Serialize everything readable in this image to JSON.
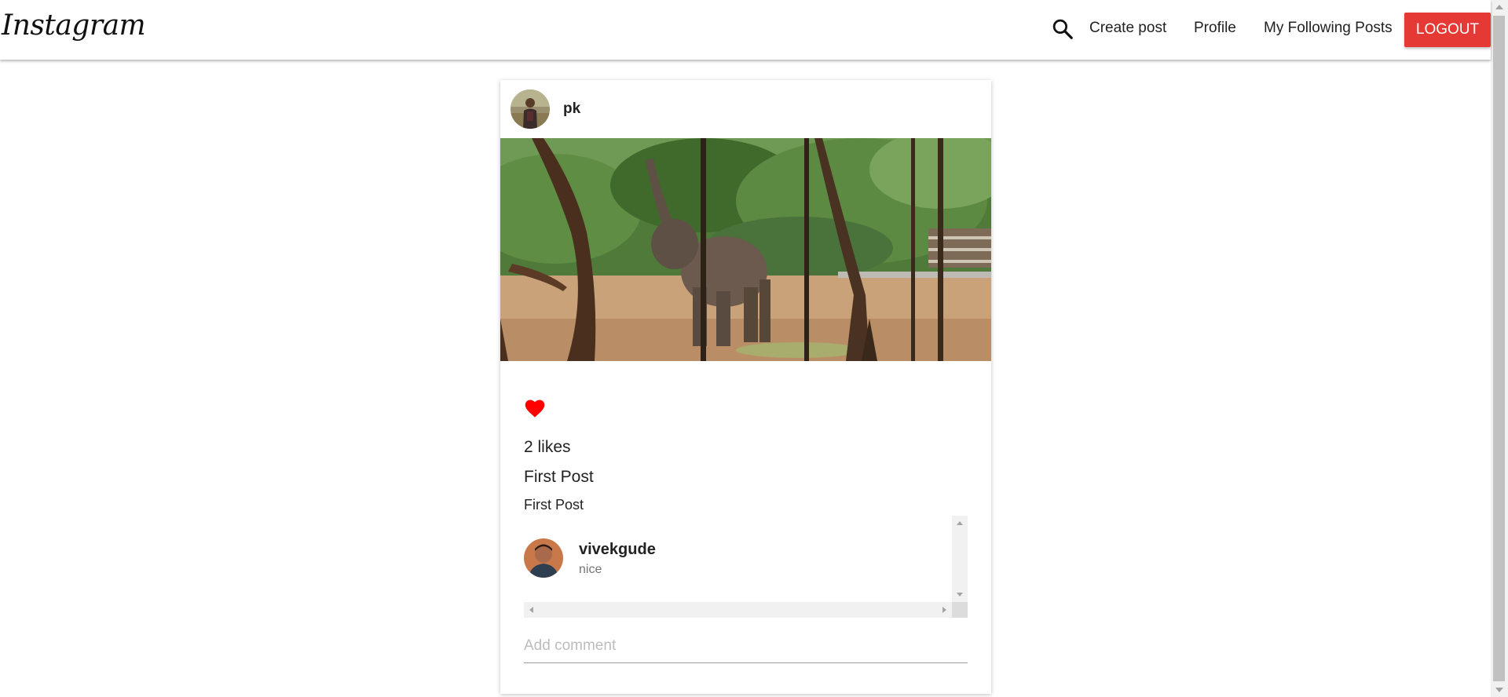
{
  "navbar": {
    "logo": "Instagram",
    "search_icon": "search-icon",
    "links": {
      "create_post": "Create post",
      "profile": "Profile",
      "following": "My Following Posts"
    },
    "logout_label": "LOGOUT",
    "logout_color": "#e53935"
  },
  "post": {
    "username": "pk",
    "like_icon": "heart-icon",
    "like_color": "#ff0000",
    "likes": "2 likes",
    "title": "First Post",
    "body": "First Post",
    "comments": [
      {
        "user": "vivekgude",
        "text": "nice"
      }
    ],
    "comment_input": {
      "placeholder": "Add comment",
      "value": ""
    }
  }
}
